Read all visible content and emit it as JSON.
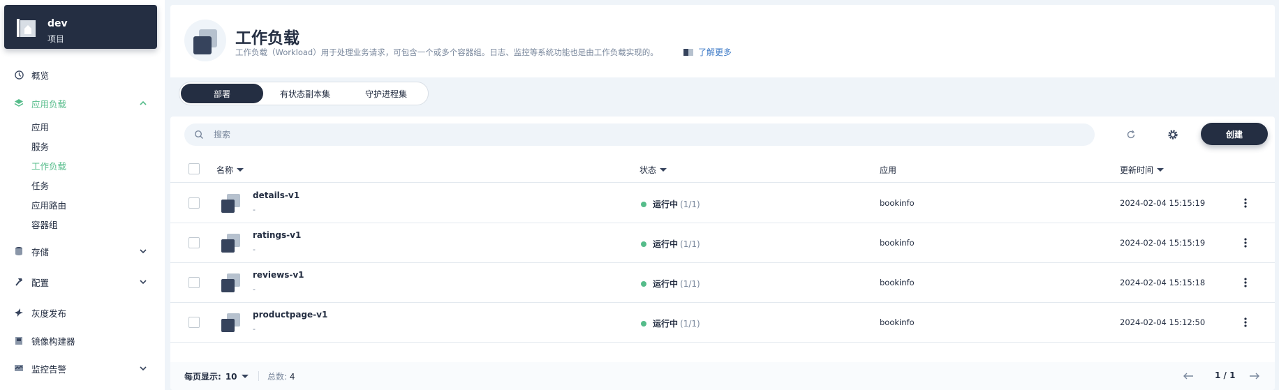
{
  "project": {
    "name": "dev",
    "type": "项目"
  },
  "nav": {
    "overview": "概览",
    "workloads": "应用负载",
    "workload_sub": [
      "应用",
      "服务",
      "工作负载",
      "任务",
      "应用路由",
      "容器组"
    ],
    "storage": "存储",
    "config": "配置",
    "grayscale": "灰度发布",
    "image_builder": "镜像构建器",
    "monitoring": "监控告警"
  },
  "header": {
    "title": "工作负载",
    "description": "工作负载（Workload）用于处理业务请求，可包含一个或多个容器组。日志、监控等系统功能也是由工作负载实现的。",
    "learn_more": "了解更多"
  },
  "tabs": [
    "部署",
    "有状态副本集",
    "守护进程集"
  ],
  "toolbar": {
    "search_placeholder": "搜索",
    "create_label": "创建"
  },
  "table": {
    "columns": {
      "name": "名称",
      "status": "状态",
      "app": "应用",
      "updated": "更新时间"
    },
    "rows": [
      {
        "name": "details-v1",
        "desc": "-",
        "status": "运行中",
        "count": "(1/1)",
        "app": "bookinfo",
        "updated": "2024-02-04 15:15:19"
      },
      {
        "name": "ratings-v1",
        "desc": "-",
        "status": "运行中",
        "count": "(1/1)",
        "app": "bookinfo",
        "updated": "2024-02-04 15:15:19"
      },
      {
        "name": "reviews-v1",
        "desc": "-",
        "status": "运行中",
        "count": "(1/1)",
        "app": "bookinfo",
        "updated": "2024-02-04 15:15:18"
      },
      {
        "name": "productpage-v1",
        "desc": "-",
        "status": "运行中",
        "count": "(1/1)",
        "app": "bookinfo",
        "updated": "2024-02-04 15:12:50"
      }
    ]
  },
  "footer": {
    "page_size_label": "每页显示:",
    "page_size": "10",
    "total_label": "总数:",
    "total": "4",
    "pager": "1 / 1"
  },
  "colors": {
    "accent": "#55bc8a",
    "dark": "#242e42",
    "link": "#3f7bc7"
  },
  "icons": [
    "dashboard-icon",
    "layers-icon",
    "database-icon",
    "hammer-icon",
    "bird-icon",
    "image-builder-icon",
    "monitor-icon",
    "chevron-up-icon",
    "chevron-down-icon",
    "search-icon",
    "refresh-icon",
    "gear-icon",
    "more-icon",
    "arrow-left-icon",
    "arrow-right-icon",
    "book-icon",
    "workload-icon"
  ]
}
